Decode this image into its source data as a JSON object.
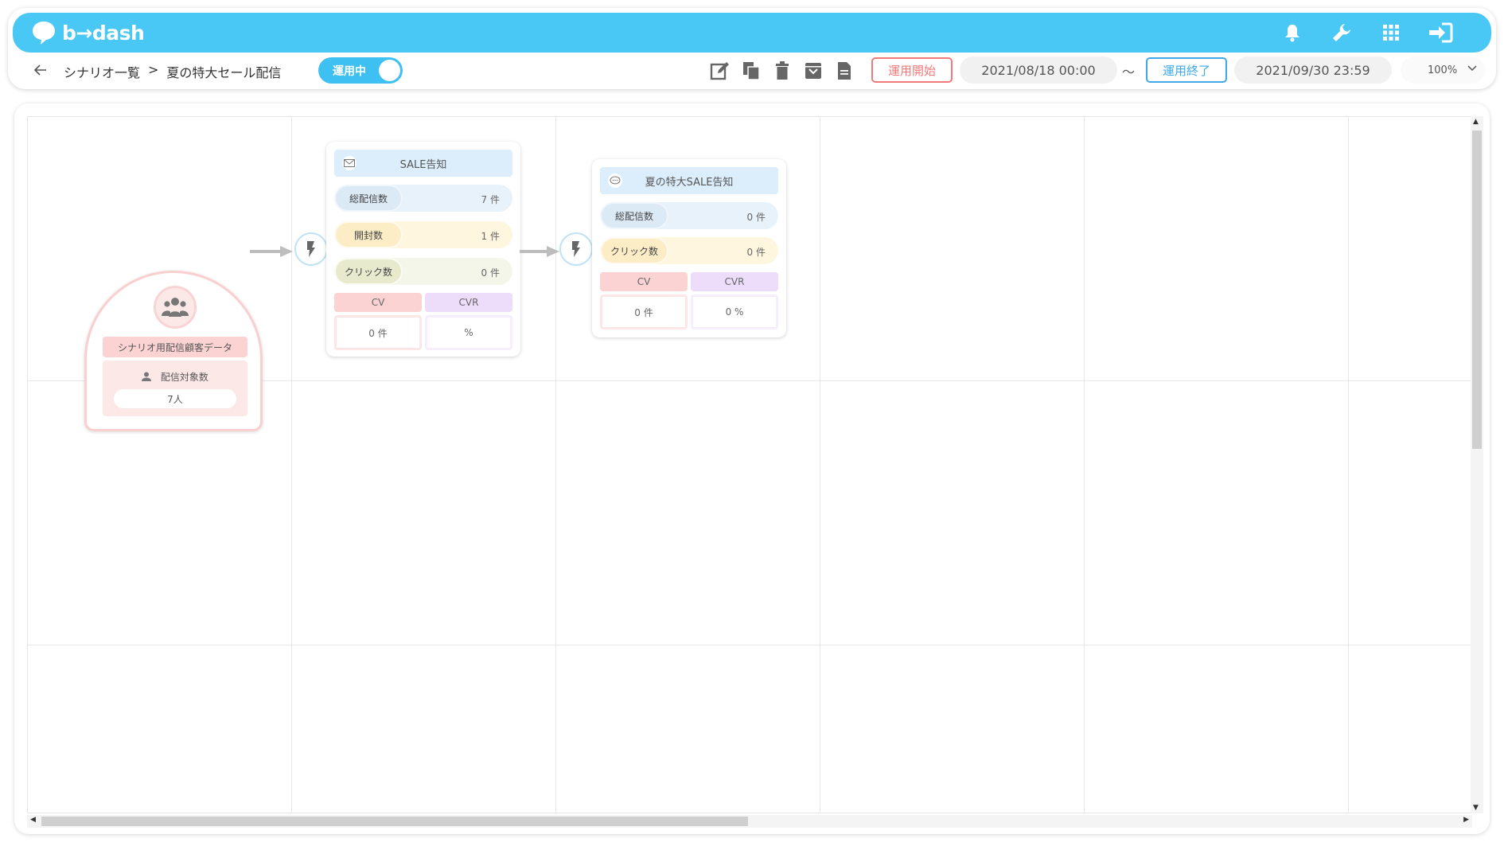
{
  "app": {
    "logo_text": "b→dash"
  },
  "breadcrumb": {
    "parent": "シナリオ一覧",
    "separator": ">",
    "current": "夏の特大セール配信"
  },
  "status_toggle": {
    "label": "運用中"
  },
  "schedule": {
    "start_button": "運用開始",
    "start_date": "2021/08/18 00:00",
    "separator": "～",
    "end_button": "運用終了",
    "end_date": "2021/09/30 23:59"
  },
  "zoom": {
    "value": "100%"
  },
  "icons": {
    "top": [
      "bell-icon",
      "wrench-icon",
      "grid-icon",
      "logout-icon"
    ],
    "toolbar": [
      "edit-icon",
      "copy-icon",
      "trash-icon",
      "archive-icon",
      "document-icon"
    ]
  },
  "colors": {
    "brand": "#4ac8f5",
    "start_accent": "#f07a7a",
    "end_accent": "#3fa9e8"
  },
  "start_node": {
    "title": "シナリオ用配信顧客データ",
    "label": "配信対象数",
    "value": "7人"
  },
  "nodes": [
    {
      "title": "SALE告知",
      "icon": "mail-icon",
      "stats": [
        {
          "label": "総配信数",
          "value": "7 件"
        },
        {
          "label": "開封数",
          "value": "1 件"
        },
        {
          "label": "クリック数",
          "value": "0 件"
        }
      ],
      "cv_label": "CV",
      "cv_value": "0 件",
      "cvr_label": "CVR",
      "cvr_value": "%"
    },
    {
      "title": "夏の特大SALE告知",
      "icon": "chat-icon",
      "stats": [
        {
          "label": "総配信数",
          "value": "0 件"
        },
        {
          "label": "クリック数",
          "value": "0 件"
        }
      ],
      "cv_label": "CV",
      "cv_value": "0 件",
      "cvr_label": "CVR",
      "cvr_value": "0 %"
    }
  ]
}
